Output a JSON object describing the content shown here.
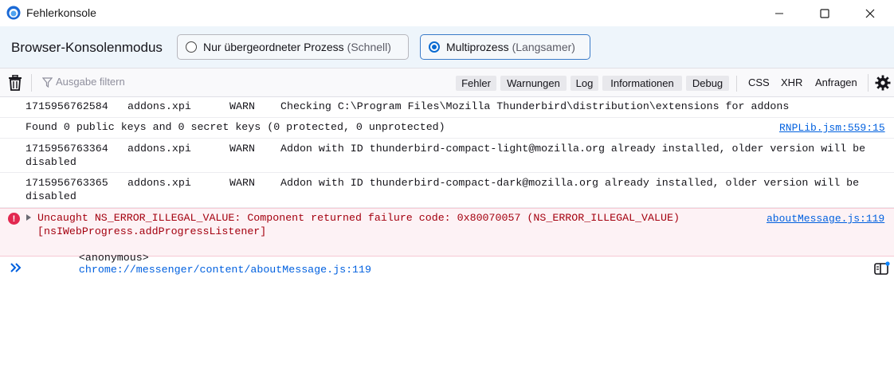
{
  "window": {
    "title": "Fehlerkonsole",
    "accent": "#0a6bd1"
  },
  "mode_bar": {
    "label": "Browser-Konsolenmodus",
    "options": [
      {
        "label": "Nur übergeordneter Prozess",
        "hint": "(Schnell)",
        "selected": false
      },
      {
        "label": "Multiprozess",
        "hint": "(Langsamer)",
        "selected": true
      }
    ]
  },
  "toolbar": {
    "clear_icon": "trash-icon",
    "filter_placeholder": "Ausgabe filtern",
    "levels": [
      "Fehler",
      "Warnungen",
      "Log",
      "Informationen",
      "Debug"
    ],
    "requests": [
      "CSS",
      "XHR",
      "Anfragen"
    ],
    "settings_icon": "gear-icon"
  },
  "messages": [
    {
      "timestamp": "1715956762584",
      "source": "addons.xpi",
      "level": "WARN",
      "text": "Checking C:\\Program Files\\Mozilla Thunderbird\\distribution\\extensions for addons"
    },
    {
      "text": "Found 0 public keys and 0 secret keys (0 protected, 0 unprotected)",
      "location": "RNPLib.jsm:559:15"
    },
    {
      "timestamp": "1715956763364",
      "source": "addons.xpi",
      "level": "WARN",
      "text": "Addon with ID thunderbird-compact-light@mozilla.org already installed, older version will be",
      "text_cont": "disabled"
    },
    {
      "timestamp": "1715956763365",
      "source": "addons.xpi",
      "level": "WARN",
      "text": "Addon with ID thunderbird-compact-dark@mozilla.org already installed, older version will be",
      "text_cont": "disabled"
    },
    {
      "type": "error",
      "text": "Uncaught NS_ERROR_ILLEGAL_VALUE: Component returned failure code: 0x80070057 (NS_ERROR_ILLEGAL_VALUE)",
      "text_cont": "[nsIWebProgress.addProgressListener]",
      "location": "aboutMessage.js:119",
      "stack_fn": "<anonymous>",
      "stack_url": "chrome://messenger/content/aboutMessage.js",
      "stack_line": ":119"
    }
  ],
  "input": {
    "prompt_icon": "chevrons-right-icon",
    "sidebar_icon": "sidebar-toggle-icon"
  }
}
